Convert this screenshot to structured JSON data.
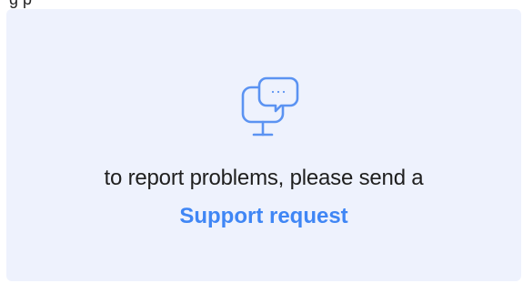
{
  "header": {
    "cut_text": "g                                              p"
  },
  "support_card": {
    "icon": "support-chat-monitor-icon",
    "message": "to report problems, please send a",
    "link_label": "Support request",
    "colors": {
      "card_background": "#eef2fd",
      "accent": "#3f86f5",
      "text": "#1f1f1f"
    }
  }
}
